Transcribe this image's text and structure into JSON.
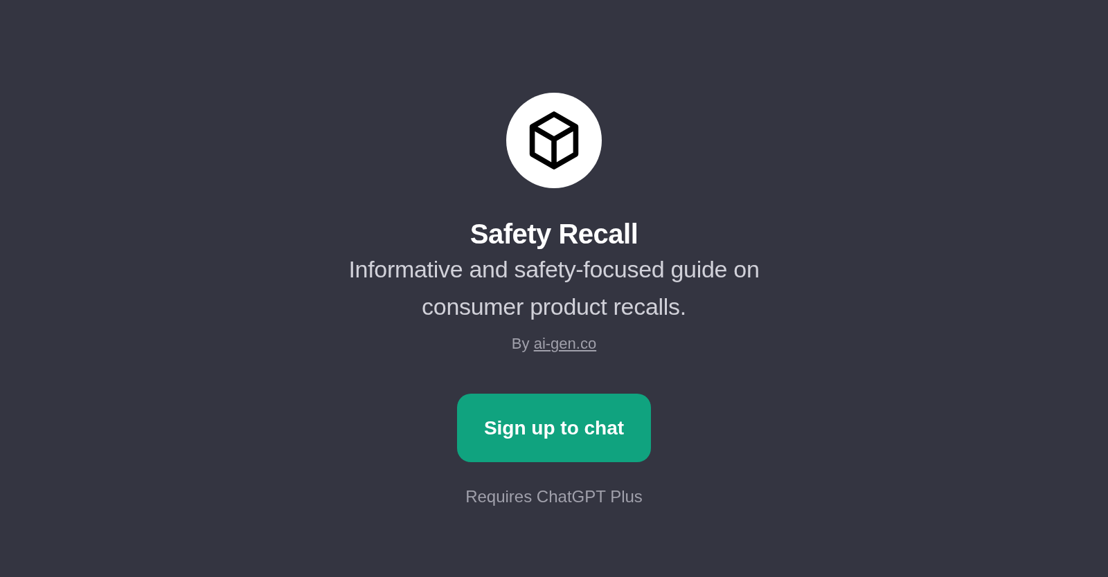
{
  "title": "Safety Recall",
  "description": "Informative and safety-focused guide on consumer product recalls.",
  "author": {
    "prefix": "By",
    "link": "ai-gen.co"
  },
  "button": {
    "label": "Sign up to chat"
  },
  "note": "Requires ChatGPT Plus"
}
